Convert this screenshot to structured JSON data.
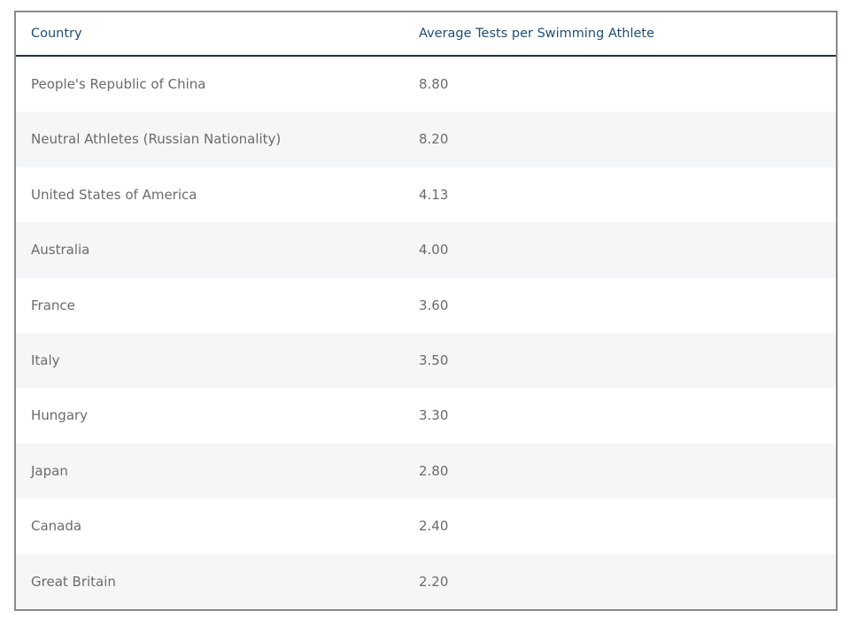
{
  "table": {
    "headers": {
      "country": "Country",
      "value": "Average Tests per Swimming Athlete"
    },
    "rows": [
      {
        "country": "People's Republic of China",
        "value": "8.80"
      },
      {
        "country": "Neutral Athletes (Russian Nationality)",
        "value": "8.20"
      },
      {
        "country": "United States of America",
        "value": "4.13"
      },
      {
        "country": "Australia",
        "value": "4.00"
      },
      {
        "country": "France",
        "value": "3.60"
      },
      {
        "country": "Italy",
        "value": "3.50"
      },
      {
        "country": "Hungary",
        "value": "3.30"
      },
      {
        "country": "Japan",
        "value": "2.80"
      },
      {
        "country": "Canada",
        "value": "2.40"
      },
      {
        "country": "Great Britain",
        "value": "2.20"
      }
    ]
  },
  "colors": {
    "header_text": "#1d4e7a",
    "body_text": "#6b6b6b",
    "stripe": "#f5f6f8",
    "border": "#8a8a8a",
    "header_rule": "#1f2f3f"
  }
}
